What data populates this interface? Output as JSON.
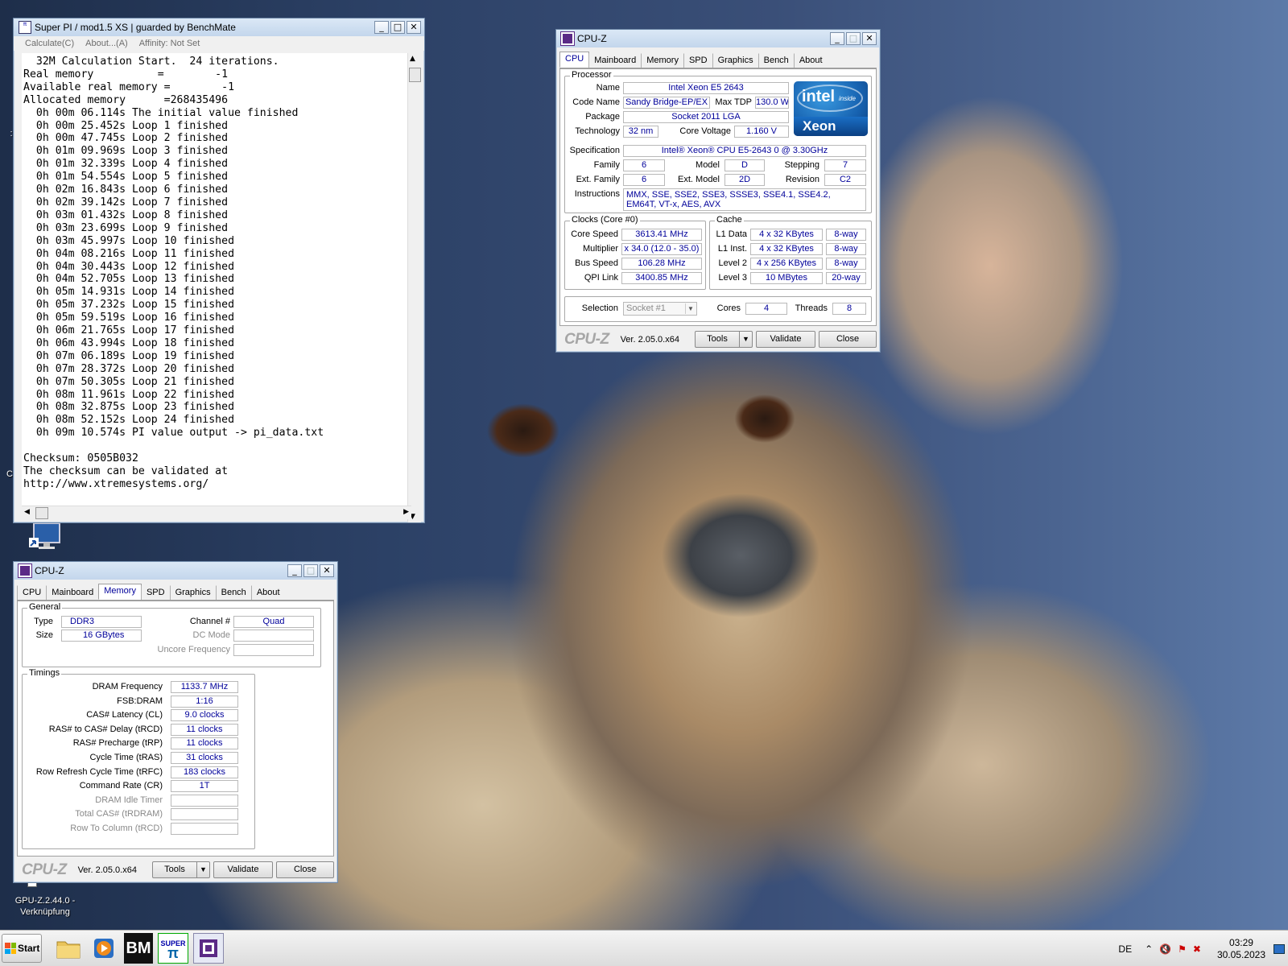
{
  "desktop": {
    "icons": [
      {
        "label": "GPU-Z.2.44.0 - Verknüpfung"
      }
    ]
  },
  "superpi": {
    "title": "Super PI / mod1.5 XS | guarded by BenchMate",
    "menu": [
      "Calculate(C)",
      "About...(A)",
      "Affinity: Not Set"
    ],
    "lines": [
      "  32M Calculation Start.  24 iterations.",
      "Real memory          =        -1",
      "Available real memory =        -1",
      "Allocated memory      =268435496",
      "  0h 00m 06.114s The initial value finished",
      "  0h 00m 25.452s Loop 1 finished",
      "  0h 00m 47.745s Loop 2 finished",
      "  0h 01m 09.969s Loop 3 finished",
      "  0h 01m 32.339s Loop 4 finished",
      "  0h 01m 54.554s Loop 5 finished",
      "  0h 02m 16.843s Loop 6 finished",
      "  0h 02m 39.142s Loop 7 finished",
      "  0h 03m 01.432s Loop 8 finished",
      "  0h 03m 23.699s Loop 9 finished",
      "  0h 03m 45.997s Loop 10 finished",
      "  0h 04m 08.216s Loop 11 finished",
      "  0h 04m 30.443s Loop 12 finished",
      "  0h 04m 52.705s Loop 13 finished",
      "  0h 05m 14.931s Loop 14 finished",
      "  0h 05m 37.232s Loop 15 finished",
      "  0h 05m 59.519s Loop 16 finished",
      "  0h 06m 21.765s Loop 17 finished",
      "  0h 06m 43.994s Loop 18 finished",
      "  0h 07m 06.189s Loop 19 finished",
      "  0h 07m 28.372s Loop 20 finished",
      "  0h 07m 50.305s Loop 21 finished",
      "  0h 08m 11.961s Loop 22 finished",
      "  0h 08m 32.875s Loop 23 finished",
      "  0h 08m 52.152s Loop 24 finished",
      "  0h 09m 10.574s PI value output -> pi_data.txt",
      "",
      "Checksum: 0505B032",
      "The checksum can be validated at",
      "http://www.xtremesystems.org/"
    ]
  },
  "cpuz_cpu": {
    "title": "CPU-Z",
    "tabs": [
      "CPU",
      "Mainboard",
      "Memory",
      "SPD",
      "Graphics",
      "Bench",
      "About"
    ],
    "processor_label": "Processor",
    "name_label": "Name",
    "name": "Intel Xeon E5 2643",
    "codename_label": "Code Name",
    "codename": "Sandy Bridge-EP/EX",
    "maxtdp_label": "Max TDP",
    "maxtdp": "130.0 W",
    "package_label": "Package",
    "package": "Socket 2011 LGA",
    "technology_label": "Technology",
    "technology": "32 nm",
    "corevoltage_label": "Core Voltage",
    "corevoltage": "1.160 V",
    "spec_label": "Specification",
    "spec": "Intel® Xeon® CPU E5-2643 0 @ 3.30GHz",
    "family_label": "Family",
    "family": "6",
    "model_label": "Model",
    "model": "D",
    "stepping_label": "Stepping",
    "stepping": "7",
    "extfamily_label": "Ext. Family",
    "extfamily": "6",
    "extmodel_label": "Ext. Model",
    "extmodel": "2D",
    "revision_label": "Revision",
    "revision": "C2",
    "instructions_label": "Instructions",
    "instructions": "MMX, SSE, SSE2, SSE3, SSSE3, SSE4.1, SSE4.2, EM64T, VT-x, AES, AVX",
    "clocks_label": "Clocks (Core #0)",
    "corespeed_label": "Core Speed",
    "corespeed": "3613.41 MHz",
    "multiplier_label": "Multiplier",
    "multiplier": "x 34.0 (12.0 - 35.0)",
    "busspeed_label": "Bus Speed",
    "busspeed": "106.28 MHz",
    "qpi_label": "QPI Link",
    "qpi": "3400.85 MHz",
    "cache_label": "Cache",
    "l1d_label": "L1 Data",
    "l1d": "4 x 32 KBytes",
    "l1d_way": "8-way",
    "l1i_label": "L1 Inst.",
    "l1i": "4 x 32 KBytes",
    "l1i_way": "8-way",
    "l2_label": "Level 2",
    "l2": "4 x 256 KBytes",
    "l2_way": "8-way",
    "l3_label": "Level 3",
    "l3": "10 MBytes",
    "l3_way": "20-way",
    "selection_label": "Selection",
    "selection": "Socket #1",
    "cores_label": "Cores",
    "cores": "4",
    "threads_label": "Threads",
    "threads": "8",
    "logo": "CPU-Z",
    "version": "Ver. 2.05.0.x64",
    "tools": "Tools",
    "validate": "Validate",
    "close": "Close",
    "badge": {
      "brand": "intel",
      "inside": "inside",
      "series": "Xeon"
    }
  },
  "cpuz_mem": {
    "title": "CPU-Z",
    "tabs": [
      "CPU",
      "Mainboard",
      "Memory",
      "SPD",
      "Graphics",
      "Bench",
      "About"
    ],
    "general_label": "General",
    "type_label": "Type",
    "type": "DDR3",
    "size_label": "Size",
    "size": "16 GBytes",
    "channel_label": "Channel #",
    "channel": "Quad",
    "dcmode_label": "DC Mode",
    "uncore_label": "Uncore Frequency",
    "timings_label": "Timings",
    "timings": [
      {
        "label": "DRAM Frequency",
        "value": "1133.7 MHz",
        "dim": false
      },
      {
        "label": "FSB:DRAM",
        "value": "1:16",
        "dim": false
      },
      {
        "label": "CAS# Latency (CL)",
        "value": "9.0 clocks",
        "dim": false
      },
      {
        "label": "RAS# to CAS# Delay (tRCD)",
        "value": "11 clocks",
        "dim": false
      },
      {
        "label": "RAS# Precharge (tRP)",
        "value": "11 clocks",
        "dim": false
      },
      {
        "label": "Cycle Time (tRAS)",
        "value": "31 clocks",
        "dim": false
      },
      {
        "label": "Row Refresh Cycle Time (tRFC)",
        "value": "183 clocks",
        "dim": false
      },
      {
        "label": "Command Rate (CR)",
        "value": "1T",
        "dim": false
      },
      {
        "label": "DRAM Idle Timer",
        "value": "",
        "dim": true
      },
      {
        "label": "Total CAS# (tRDRAM)",
        "value": "",
        "dim": true
      },
      {
        "label": "Row To Column (tRCD)",
        "value": "",
        "dim": true
      }
    ],
    "logo": "CPU-Z",
    "version": "Ver. 2.05.0.x64",
    "tools": "Tools",
    "validate": "Validate",
    "close": "Close"
  },
  "taskbar": {
    "start": "Start",
    "lang": "DE",
    "time": "03:29",
    "date": "30.05.2023",
    "apps": [
      {
        "icon": "folder-icon"
      },
      {
        "icon": "media-player-icon"
      },
      {
        "icon": "benchmate-icon",
        "text": "BM"
      },
      {
        "icon": "superpi-icon",
        "text": "SUPER"
      },
      {
        "icon": "cpuz-icon"
      }
    ]
  }
}
